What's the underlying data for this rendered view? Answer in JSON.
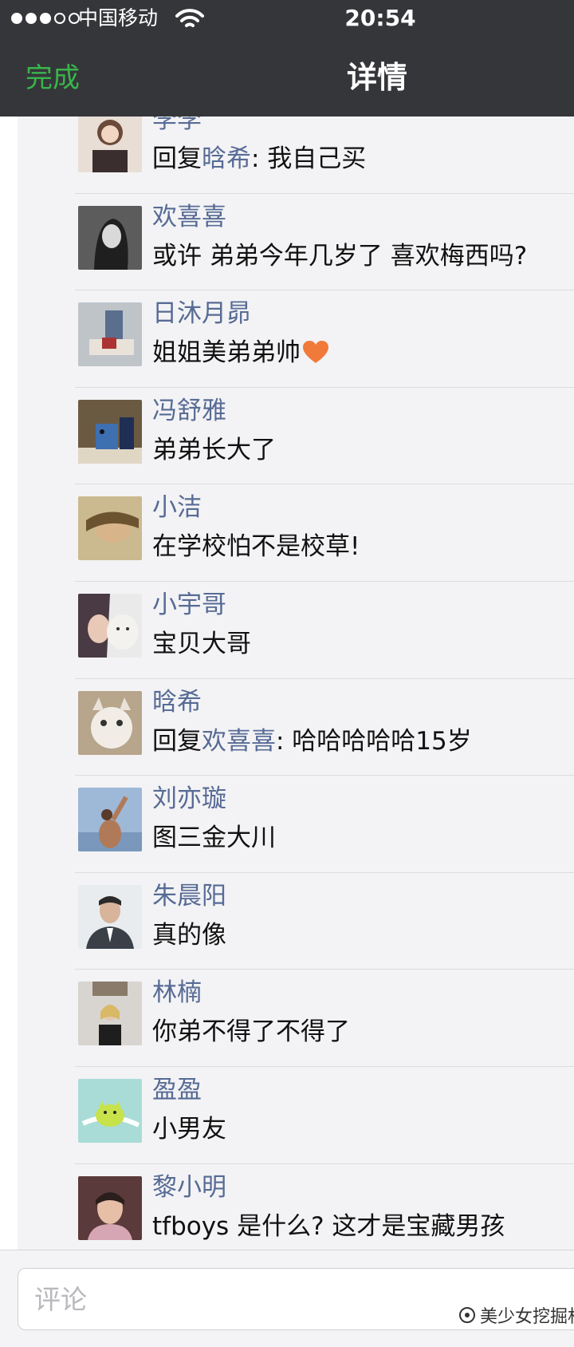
{
  "status_bar": {
    "carrier": "中国移动",
    "time": "20:54"
  },
  "nav": {
    "left_label": "完成",
    "title": "详情"
  },
  "comments": [
    {
      "name": "李李",
      "prefix": "回复",
      "reply_to": "晗希",
      "text": ": 我自己买",
      "avatar_icon": "girl-illustration-avatar"
    },
    {
      "name": "欢喜喜",
      "prefix": "",
      "reply_to": "",
      "text": "或许 弟弟今年几岁了 喜欢梅西吗?",
      "avatar_icon": "bw-girl-avatar"
    },
    {
      "name": "日沐月昴",
      "prefix": "",
      "reply_to": "",
      "text": "姐姐美弟弟帅",
      "has_heart": true,
      "avatar_icon": "person-sitting-avatar"
    },
    {
      "name": "冯舒雅",
      "prefix": "",
      "reply_to": "",
      "text": "弟弟长大了",
      "avatar_icon": "blue-robot-avatar"
    },
    {
      "name": "小洁",
      "prefix": "",
      "reply_to": "",
      "text": "在学校怕不是校草!",
      "avatar_icon": "girl-lying-avatar"
    },
    {
      "name": "小宇哥",
      "prefix": "",
      "reply_to": "",
      "text": "宝贝大哥",
      "avatar_icon": "girl-with-cat-avatar"
    },
    {
      "name": "晗希",
      "prefix": "回复",
      "reply_to": "欢喜喜",
      "text": ": 哈哈哈哈哈15岁",
      "avatar_icon": "cat-avatar"
    },
    {
      "name": "刘亦璇",
      "prefix": "",
      "reply_to": "",
      "text": "图三金大川",
      "avatar_icon": "person-sky-avatar"
    },
    {
      "name": "朱晨阳",
      "prefix": "",
      "reply_to": "",
      "text": "真的像",
      "avatar_icon": "man-suit-avatar"
    },
    {
      "name": "林楠",
      "prefix": "",
      "reply_to": "",
      "text": "你弟不得了不得了",
      "avatar_icon": "girl-mirror-avatar"
    },
    {
      "name": "盈盈",
      "prefix": "",
      "reply_to": "",
      "text": "小男友",
      "avatar_icon": "green-cartoon-avatar"
    },
    {
      "name": "黎小明",
      "prefix": "",
      "reply_to": "",
      "text": "tfboys 是什么? 这才是宝藏男孩",
      "avatar_icon": "boy-portrait-avatar"
    }
  ],
  "input": {
    "placeholder": "评论"
  },
  "watermark": {
    "text": "美少女挖掘机"
  },
  "colors": {
    "top_bar": "#35363a",
    "done_green": "#39b54a",
    "name_blue": "#576b95",
    "list_bg": "#f3f3f5"
  }
}
